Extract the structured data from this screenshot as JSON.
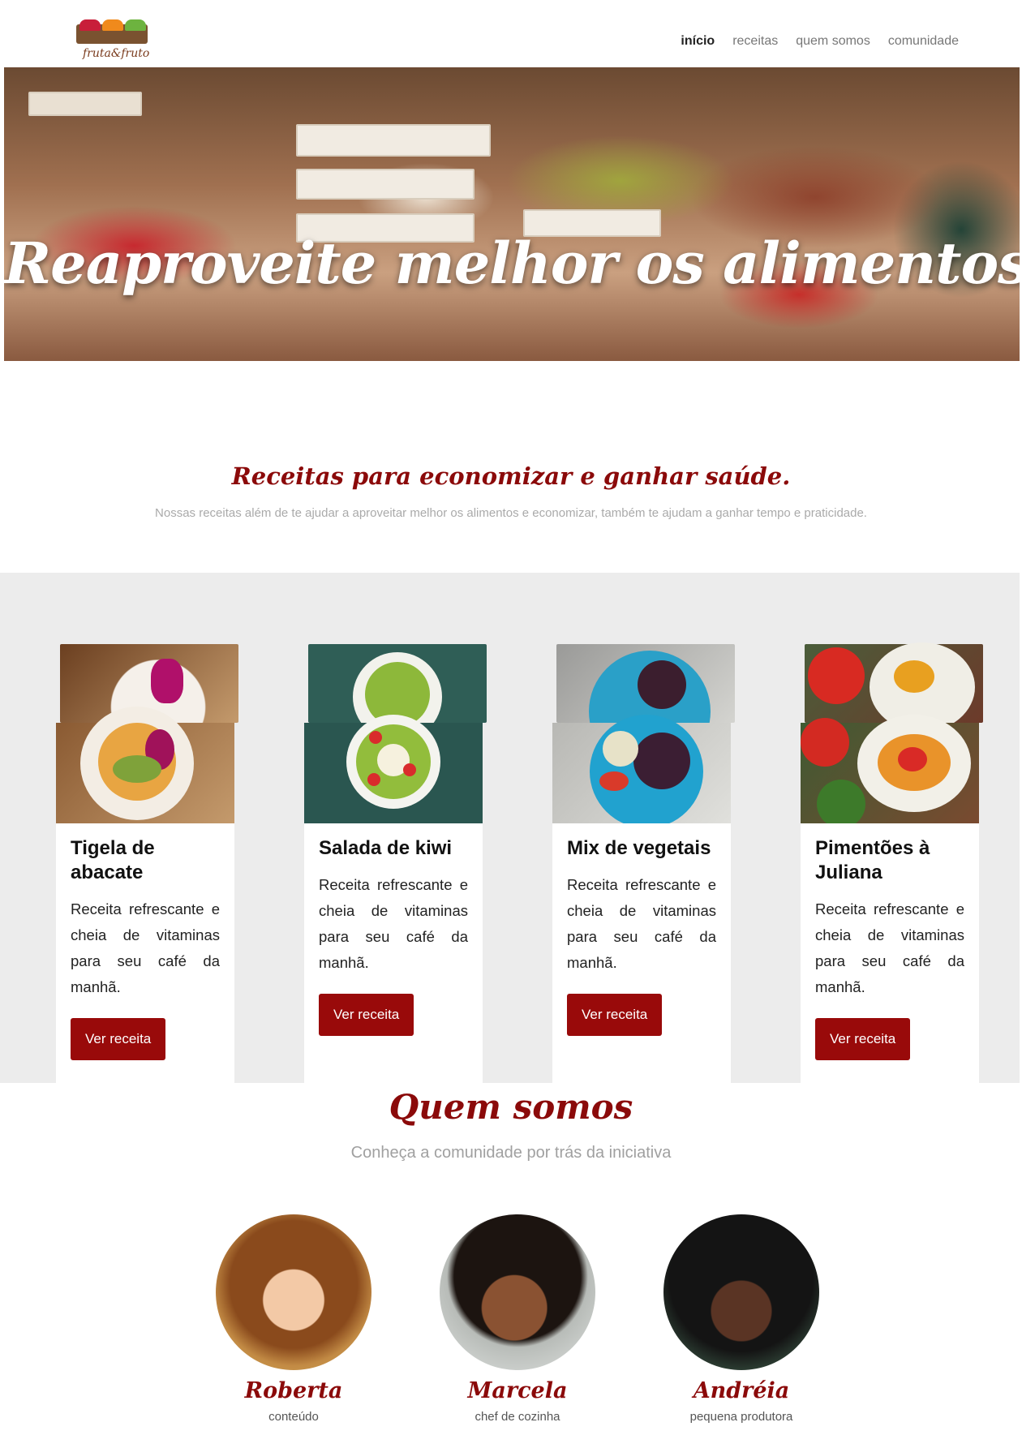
{
  "brand": {
    "logo_text": "fruta&fruto",
    "colors": {
      "primary": "#8b0a0a",
      "button": "#990a0a",
      "band": "#ececec"
    }
  },
  "nav": {
    "items": [
      {
        "label": "início",
        "active": true
      },
      {
        "label": "receitas",
        "active": false
      },
      {
        "label": "quem somos",
        "active": false
      },
      {
        "label": "comunidade",
        "active": false
      }
    ]
  },
  "hero": {
    "title": "Reaproveite melhor os alimentos!",
    "image": "market-produce-photo"
  },
  "recipes": {
    "heading": "Receitas para economizar e ganhar saúde.",
    "subheading": "Nossas receitas além de te ajudar a aproveitar melhor os alimentos e economizar, também te ajudam a ganhar tempo e praticidade.",
    "cards": [
      {
        "title": "Tigela de abacate",
        "text": "Receita refrescante e cheia de vitaminas para seu café da manhã.",
        "button": "Ver receita",
        "image": "avocado-bowl-photo"
      },
      {
        "title": "Salada de kiwi",
        "text": "Receita refrescante e cheia de vitaminas para seu café da manhã.",
        "button": "Ver receita",
        "image": "kiwi-salad-photo"
      },
      {
        "title": "Mix de vegetais",
        "text": "Receita refrescante e cheia de vitaminas para seu café da manhã.",
        "button": "Ver receita",
        "image": "vegetable-mix-photo"
      },
      {
        "title": "Pimentões à Juliana",
        "text": "Receita refrescante e cheia de vitaminas para seu café da manhã.",
        "button": "Ver receita",
        "image": "julienne-peppers-photo"
      }
    ]
  },
  "about": {
    "heading": "Quem somos",
    "subheading": "Conheça a comunidade por trás da iniciativa",
    "members": [
      {
        "name": "Roberta",
        "role": "conteúdo"
      },
      {
        "name": "Marcela",
        "role": "chef de cozinha"
      },
      {
        "name": "Andréia",
        "role": "pequena produtora"
      }
    ]
  }
}
